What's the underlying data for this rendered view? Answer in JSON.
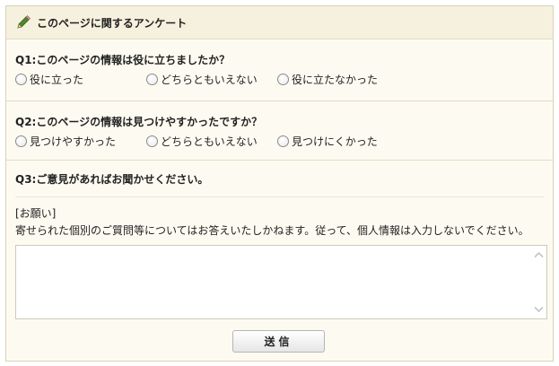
{
  "survey": {
    "title": "このページに関するアンケート",
    "icon": "pencil-icon",
    "accent": "#4e8a2e",
    "q1": {
      "label": "Q1:このページの情報は役に立ちましたか？",
      "options": [
        "役に立った",
        "どちらともいえない",
        "役に立たなかった"
      ]
    },
    "q2": {
      "label": "Q2:このページの情報は見つけやすかったですか？",
      "options": [
        "見つけやすかった",
        "どちらともいえない",
        "見つけにくかった"
      ]
    },
    "q3": {
      "label": "Q3:ご意見があればお聞かせください。",
      "notice_title": "[お願い]",
      "notice_text": "寄せられた個別のご質問等についてはお答えいたしかねます。従って、個人情報は入力しないでください。"
    },
    "submit_label": "送信"
  }
}
